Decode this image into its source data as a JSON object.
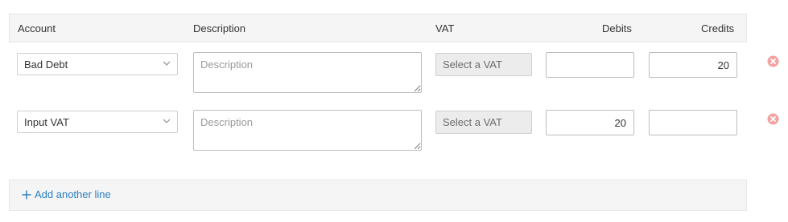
{
  "columns": {
    "account": "Account",
    "description": "Description",
    "vat": "VAT",
    "debits": "Debits",
    "credits": "Credits"
  },
  "rows": [
    {
      "account": "Bad Debt",
      "description_placeholder": "Description",
      "vat": "Select a VAT",
      "debit": "",
      "credit": "20"
    },
    {
      "account": "Input VAT",
      "description_placeholder": "Description",
      "vat": "Select a VAT",
      "debit": "20",
      "credit": ""
    }
  ],
  "footer": {
    "add_line_label": "Add another line"
  },
  "icons": {
    "chevron": "chevron-down-icon",
    "remove": "remove-circle-icon",
    "add": "plus-icon"
  },
  "colors": {
    "accent": "#2a7fbf",
    "remove": "#f4a3a3"
  }
}
